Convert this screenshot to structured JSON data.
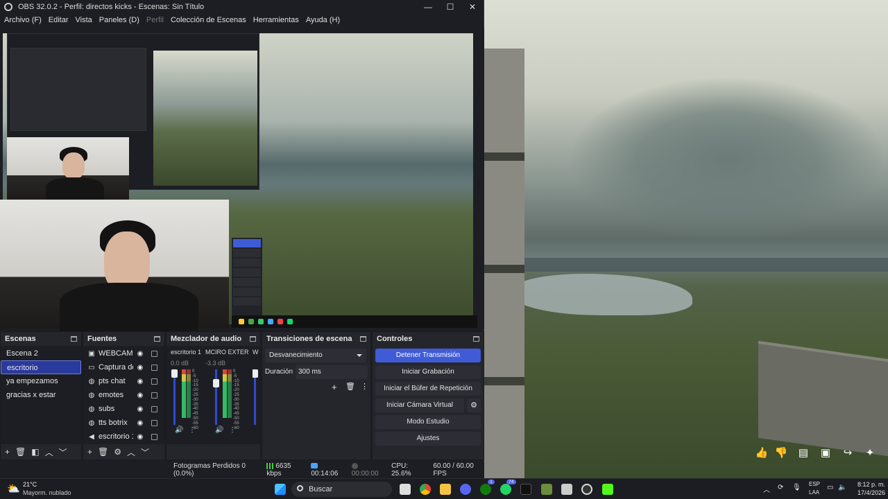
{
  "window": {
    "title": "OBS 32.0.2 - Perfil: directos kicks - Escenas: Sin Título",
    "controls": {
      "minimize": "—",
      "maximize": "☐",
      "close": "✕"
    }
  },
  "menu": [
    "Archivo (F)",
    "Editar",
    "Vista",
    "Paneles (D)",
    "Perfil",
    "Colección de Escenas",
    "Herramientas",
    "Ayuda (H)"
  ],
  "docks": {
    "scenes": {
      "title": "Escenas",
      "items": [
        "Escena 2",
        "escritorio",
        "ya empezamos",
        "gracias x estar"
      ],
      "selected": "escritorio"
    },
    "sources": {
      "title": "Fuentes",
      "items": [
        {
          "icon": "camera-icon",
          "glyph": "▣",
          "label": "WEBCAM"
        },
        {
          "icon": "window-capture-icon",
          "glyph": "▭",
          "label": "Captura de v"
        },
        {
          "icon": "browser-icon",
          "glyph": "◍",
          "label": "pts chat"
        },
        {
          "icon": "browser-icon",
          "glyph": "◍",
          "label": "emotes"
        },
        {
          "icon": "browser-icon",
          "glyph": "◍",
          "label": "subs"
        },
        {
          "icon": "browser-icon",
          "glyph": "◍",
          "label": "tts botrix"
        },
        {
          "icon": "speaker-icon",
          "glyph": "◀",
          "label": "escritorio 1"
        }
      ]
    },
    "mixer": {
      "title": "Mezclador de audio",
      "channels": [
        {
          "name": "escritorio 1",
          "db": "0.0 dB"
        },
        {
          "name": "MCIRO EXTERNO",
          "db": "-3.3 dB"
        },
        {
          "name": "W",
          "db": ""
        }
      ],
      "scale": [
        "0",
        "-5",
        "-10",
        "-15",
        "-20",
        "-25",
        "-30",
        "-35",
        "-40",
        "-45",
        "-50",
        "-55",
        "-60"
      ]
    },
    "transitions": {
      "title": "Transiciones de escena",
      "selected": "Desvanecimiento",
      "duration_label": "Duración",
      "duration_value": "300 ms"
    },
    "controls": {
      "title": "Controles",
      "buttons": [
        "Detener Transmisión",
        "Iniciar Grabación",
        "Iniciar el Búfer de Repetición",
        "Iniciar Cámara Virtual",
        "Modo Estudio",
        "Ajustes"
      ]
    }
  },
  "status": {
    "dropped": "Fotogramas Perdidos 0 (0.0%)",
    "bitrate": "6635 kbps",
    "stream_time": "00:14:06",
    "rec_time": "00:00:00",
    "cpu": "CPU: 25.6%",
    "fps": "60.00 / 60.00 FPS"
  },
  "taskbar": {
    "weather_temp": "21°C",
    "weather_desc": "Mayorm. nublado",
    "search": "Buscar",
    "lang_top": "ESP",
    "lang_bottom": "LAA",
    "time": "8:12 p. m.",
    "date": "17/4/2026",
    "badges": {
      "discord": "1",
      "whatsapp": "74"
    }
  },
  "colors": {
    "accent": "#3f5bd6",
    "bg": "#1d1e23",
    "panel": "#25262c"
  }
}
